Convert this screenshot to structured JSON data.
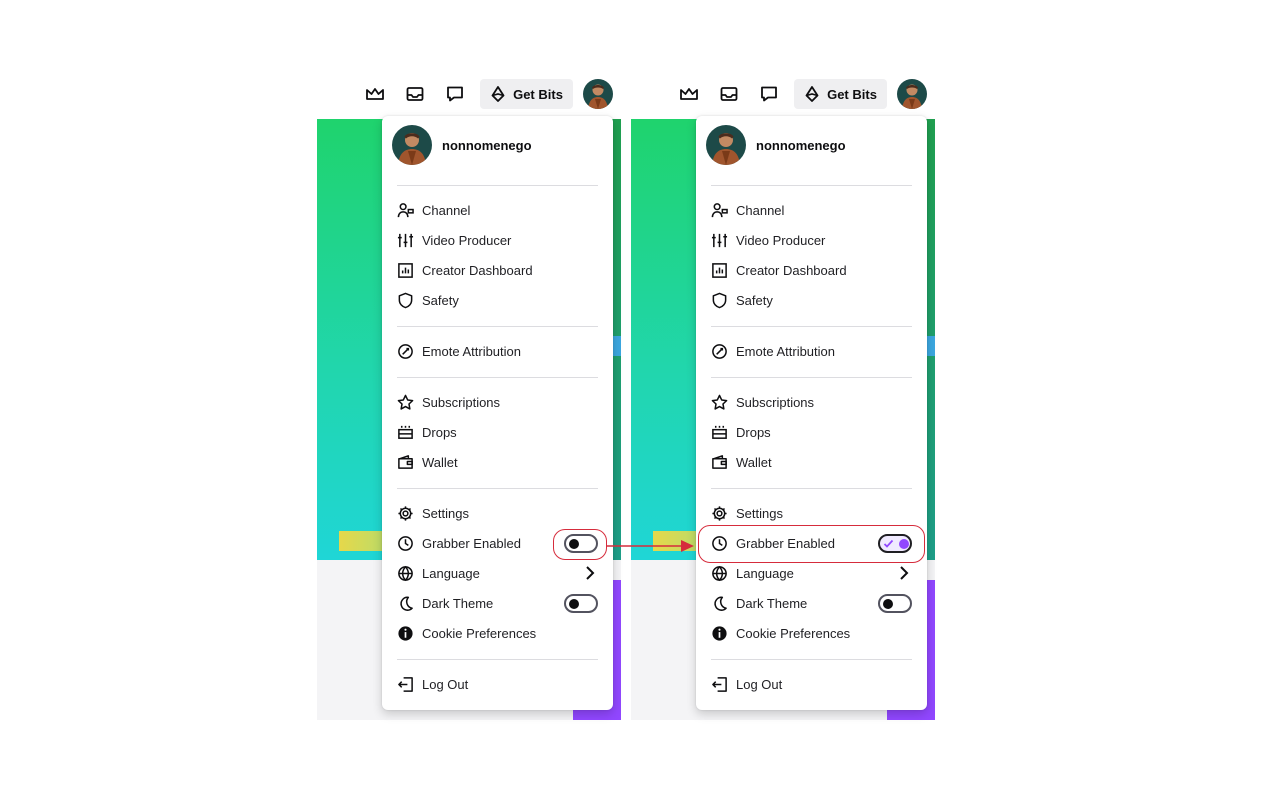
{
  "nav": {
    "get_bits_label": "Get Bits",
    "icons": [
      "crown-icon",
      "inbox-icon",
      "whispers-icon",
      "bits-icon"
    ]
  },
  "user": {
    "name": "nonnomenego"
  },
  "menu": {
    "channel": "Channel",
    "video_producer": "Video Producer",
    "creator_dashboard": "Creator Dashboard",
    "safety": "Safety",
    "emote_attribution": "Emote Attribution",
    "subscriptions": "Subscriptions",
    "drops": "Drops",
    "wallet": "Wallet",
    "settings": "Settings",
    "grabber_enabled": "Grabber Enabled",
    "language": "Language",
    "dark_theme": "Dark Theme",
    "cookie_preferences": "Cookie Preferences",
    "log_out": "Log Out"
  },
  "states": {
    "before": {
      "grabber_enabled": false,
      "dark_theme": false
    },
    "after": {
      "grabber_enabled": true,
      "dark_theme": false
    }
  },
  "colors": {
    "accent": "#9147ff",
    "highlight": "#d62c3c",
    "bits_bg": "#efeff1",
    "gradient_top": "#1fd36d",
    "gradient_bottom": "#1fd6d6"
  }
}
